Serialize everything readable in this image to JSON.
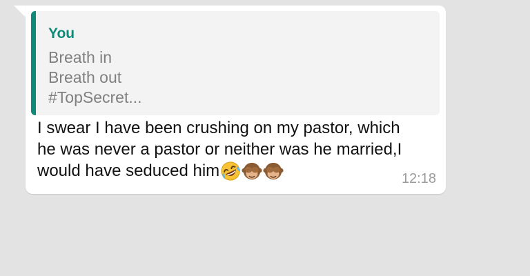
{
  "quoted": {
    "author": "You",
    "lines": [
      "Breath in",
      "Breath out",
      "#TopSecret..."
    ]
  },
  "message": {
    "lines": [
      "I swear I have been crushing on my pastor, which",
      "he was never a pastor or neither was he married,I",
      "would have seduced him"
    ],
    "emojis": [
      "rolling-on-floor-laughing-emoji",
      "see-no-evil-monkey-emoji",
      "see-no-evil-monkey-emoji"
    ]
  },
  "time": "12:18",
  "colors": {
    "background": "#e3e3e3",
    "bubble": "#ffffff",
    "quote_accent": "#0f8a78",
    "quote_background": "#f3f3f3"
  }
}
